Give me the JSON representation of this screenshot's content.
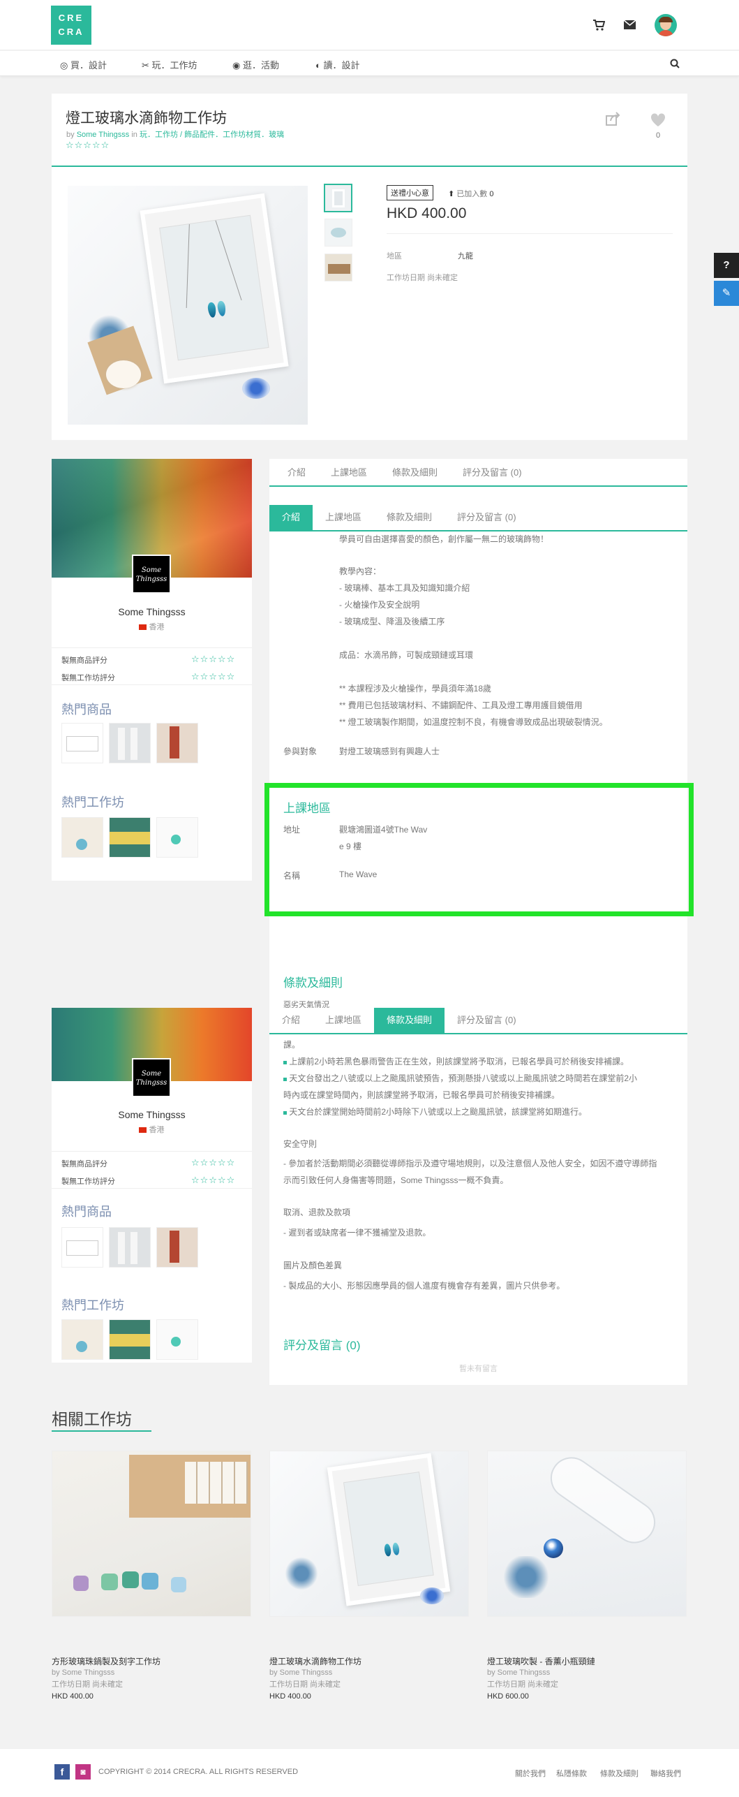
{
  "logo": {
    "line1": "CRE",
    "line2": "CRA"
  },
  "nav": {
    "items": [
      "買．設計",
      "玩．工作坊",
      "逛．活動",
      "讀．設計"
    ]
  },
  "product": {
    "title": "燈工玻璃水滴飾物工作坊",
    "by_prefix": "by",
    "author": "Some Thingsss",
    "in_word": "in",
    "category_path": "玩．工作坊 / 飾品配件．工作坊材質．玻璃",
    "stars": "☆☆☆☆☆",
    "like_count": "0",
    "gift_tag": "送禮小心意",
    "added_label": "已加入數",
    "added_count": "0",
    "price": "HKD 400.00",
    "area_label": "地區",
    "area_value": "九龍",
    "date_label": "工作坊日期",
    "date_value": "尚未確定"
  },
  "shop": {
    "name": "Some Thingsss",
    "logo_text": "Some Thingsss",
    "country": "香港",
    "rating_product_label": "製無商品評分",
    "rating_workshop_label": "製無工作坊評分",
    "stars": "☆☆☆☆☆",
    "hot_products": "熱門商品",
    "hot_workshops": "熱門工作坊"
  },
  "tabs": [
    "介紹",
    "上課地區",
    "條款及細則",
    "評分及留言 (0)"
  ],
  "intro": {
    "lines": [
      "學員可自由選擇喜愛的顏色，創作屬一無二的玻璃飾物！",
      "教學內容：",
      "- 玻璃棒、基本工具及知識知識介紹",
      "- 火槍操作及安全說明",
      "- 玻璃成型、降溫及後續工序",
      "成品：水滴吊飾，可製成頸鏈或耳環",
      "** 本課程涉及火槍操作，學員須年滿18歲",
      "** 費用已包括玻璃材料、不鏽鋼配件、工具及燈工專用護目鏡借用",
      "** 燈工玻璃製作期間，如溫度控制不良，有機會導致成品出現破裂情況。"
    ],
    "target_label": "參與對象",
    "target_value": "對燈工玻璃感到有興趣人士"
  },
  "location": {
    "heading": "上課地區",
    "address_label": "地址",
    "address_line1": "觀塘鴻圖道4號The Wav",
    "address_line2": "e 9 樓",
    "name_label": "名稱",
    "name_value": "The Wave"
  },
  "terms": {
    "heading": "條款及細則",
    "sub": "惡劣天氣情況",
    "lines": [
      "課。",
      "上課前2小時若黑色暴雨警告正在生效，則該課堂將予取消，已報名學員可於稍後安排補課。",
      "天文台發出之八號或以上之颱風訊號預告，預測懸掛八號或以上颱風訊號之時間若在課堂前2小",
      "時內或在課堂時間內，則該課堂將予取消，已報名學員可於稍後安排補課。",
      "天文台於課堂開始時間前2小時除下八號或以上之颱風訊號，該課堂將如期進行。"
    ],
    "safety_heading": "安全守則",
    "safety_line1": "- 參加者於活動期間必須聽從導師指示及遵守場地規則，以及注意個人及他人安全，如因不遵守導師指",
    "safety_line2": "示而引致任何人身傷害等問題，Some Thingsss一概不負責。",
    "refund_heading": "取消、退款及款項",
    "refund_line": "- 遲到者或缺席者一律不獲補堂及退款。",
    "photo_heading": "圖片及顏色差異",
    "photo_line": "- 製成品的大小、形態因應學員的個人進度有機會存有差異，圖片只供參考。"
  },
  "reviews": {
    "heading": "評分及留言 (0)",
    "empty": "暫未有留言"
  },
  "related": {
    "heading": "相關工作坊",
    "items": [
      {
        "title": "方形玻璃珠鍋製及刻字工作坊",
        "author": "by Some Thingsss",
        "date": "工作坊日期 尚未確定",
        "price": "HKD 400.00"
      },
      {
        "title": "燈工玻璃水滴飾物工作坊",
        "author": "by Some Thingsss",
        "date": "工作坊日期 尚未確定",
        "price": "HKD 400.00"
      },
      {
        "title": "燈工玻璃吹製 - 香薰小瓶頸鏈",
        "author": "by Some Thingsss",
        "date": "工作坊日期 尚未確定",
        "price": "HKD 600.00"
      }
    ]
  },
  "footer": {
    "copyright": "COPYRIGHT © 2014 CRECRA. ALL RIGHTS RESERVED",
    "links": [
      "關於我們",
      "私隱條款",
      "條款及細則",
      "聯絡我們"
    ]
  },
  "colors": {
    "accent": "#2bb99b",
    "highlight": "#22e32a"
  }
}
